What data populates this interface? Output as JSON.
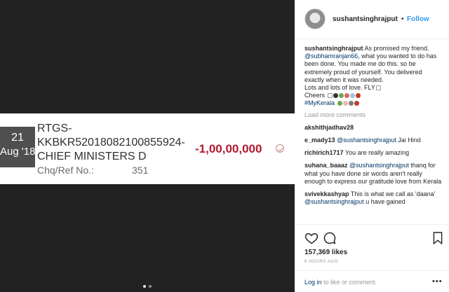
{
  "receipt": {
    "date_day": "21",
    "date_month": "Aug '18",
    "desc_lines": [
      "RTGS-",
      "KKBKR52018082100855924-",
      "CHIEF MINISTERS D"
    ],
    "ref_label": "Chq/Ref No.:",
    "ref_value": "351",
    "amount": "-1,00,00,000"
  },
  "carousel": {
    "dots": 2,
    "active_index": 0
  },
  "header": {
    "username": "sushantsinghrajput",
    "separator": "•",
    "follow_label": "Follow"
  },
  "caption": {
    "username": "sushantsinghrajput",
    "text1": "As promised my friend.",
    "mention": "@subhamranjan66",
    "text2": ", what you wanted to do has been done. You made me do this. so be extremely proud of yourself. You delivered exactly when it was needed.",
    "line3": "Lots and lots of love. FLY",
    "line4": "Cheers",
    "hashtag": "#MyKerala"
  },
  "load_more_label": "Load more comments",
  "comments": [
    {
      "user": "akshithjadhav28",
      "segments": []
    },
    {
      "user": "e_mady13",
      "segments": [
        {
          "type": "mention",
          "text": "@sushantsinghrajput"
        },
        {
          "type": "text",
          "text": " Jai Hind"
        }
      ]
    },
    {
      "user": "richirich1717",
      "segments": [
        {
          "type": "text",
          "text": "You are really amazing"
        }
      ]
    },
    {
      "user": "suhana_baaaz",
      "segments": [
        {
          "type": "mention",
          "text": "@sushantsinghrajput"
        },
        {
          "type": "text",
          "text": " thanq for what you have done sir"
        },
        {
          "type": "text",
          "text": " words aren't really enough to express our gratitude"
        },
        {
          "type": "text",
          "text": " love from Kerala"
        }
      ]
    },
    {
      "user": "svivekkashyap",
      "segments": [
        {
          "type": "text",
          "text": "This is what we call as 'daana' "
        },
        {
          "type": "mention",
          "text": "@sushantsinghrajput"
        },
        {
          "type": "text",
          "text": " u have gained"
        }
      ]
    }
  ],
  "likes": "157,369 likes",
  "time": "6 HOURS AGO",
  "footer": {
    "login_label": "Log in",
    "rest": " to like or comment."
  },
  "colors": {
    "accent": "#3897f0",
    "link": "#003569",
    "amount_red": "#b0192e",
    "media_bg": "#222222",
    "date_box": "#4f4f4f"
  },
  "icons": [
    "heart-icon",
    "comment-icon",
    "bookmark-icon",
    "more-icon"
  ]
}
